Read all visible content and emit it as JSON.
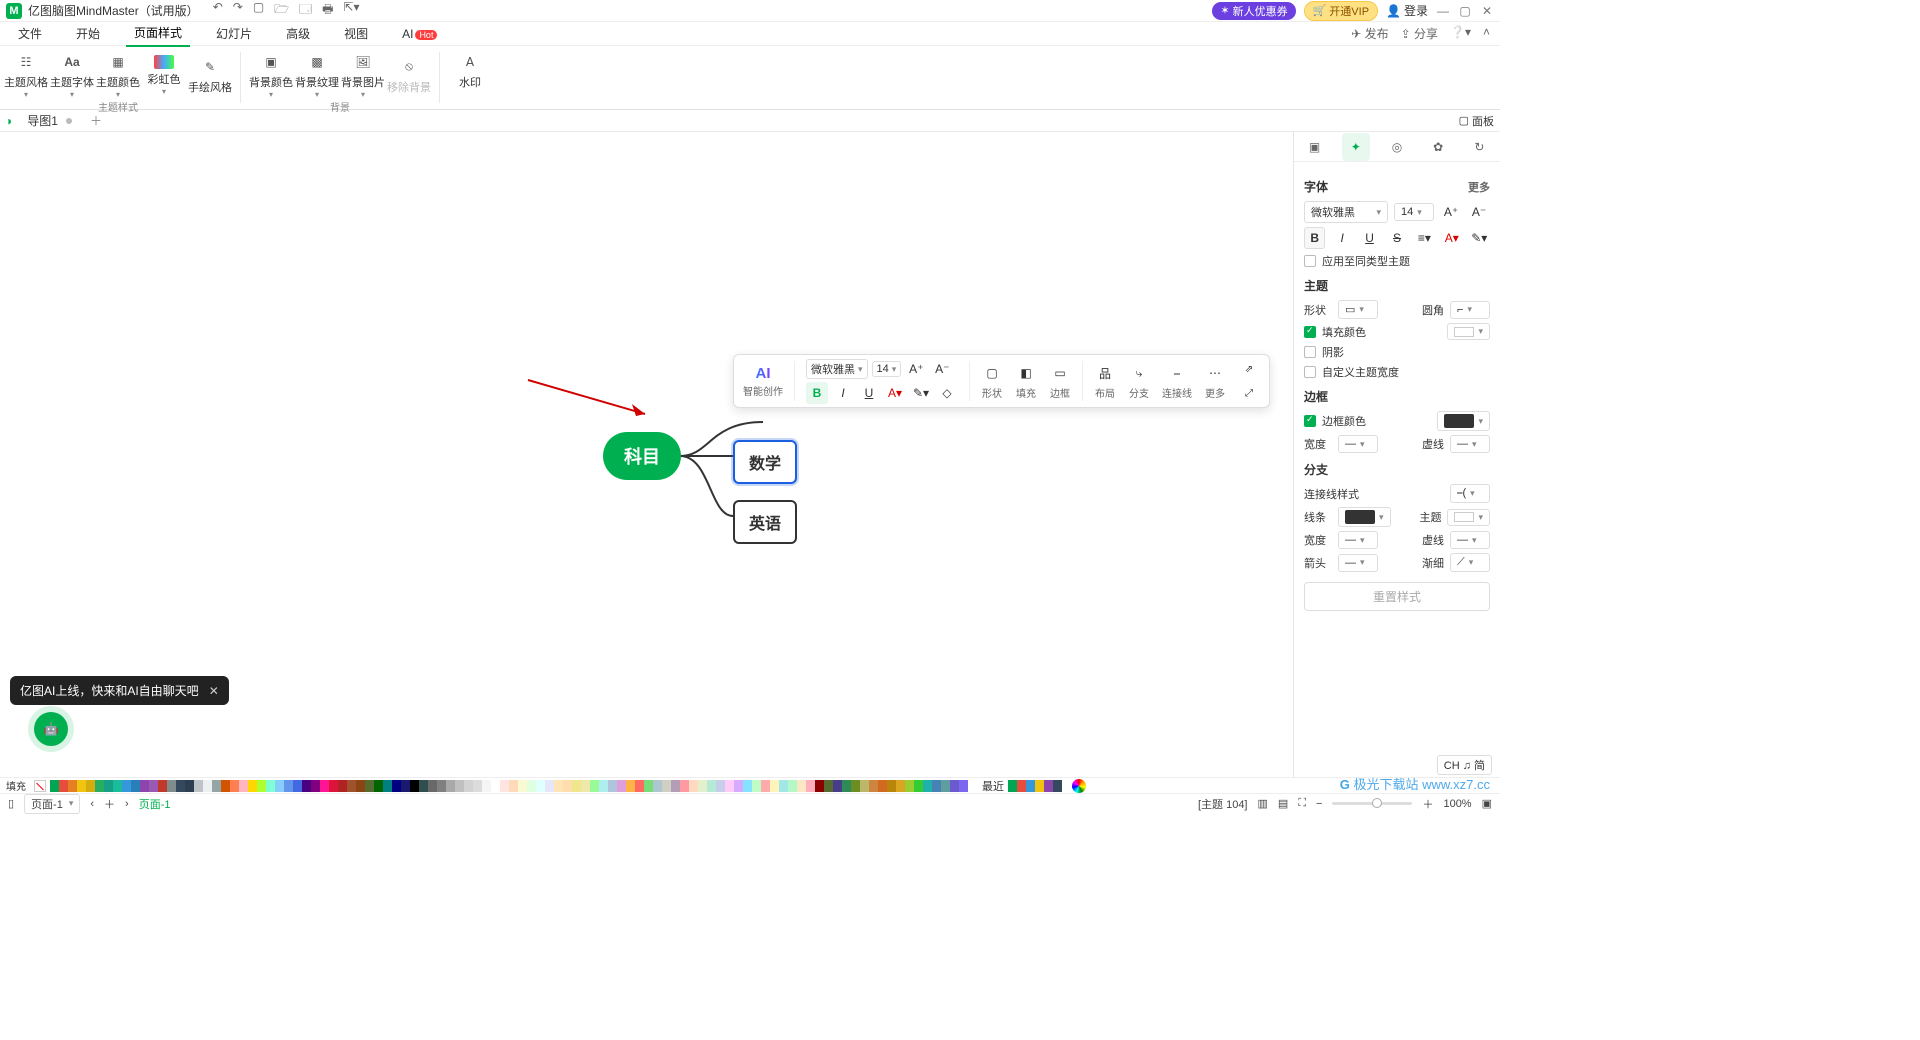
{
  "title": "亿图脑图MindMaster（试用版）",
  "titlebar_right": {
    "coupon": "新人优惠券",
    "vip": "开通VIP",
    "login": "登录"
  },
  "menubar": {
    "items": [
      "文件",
      "开始",
      "页面样式",
      "幻灯片",
      "高级",
      "视图",
      "AI"
    ],
    "active_index": 2,
    "right": {
      "publish": "发布",
      "share": "分享"
    }
  },
  "ribbon": {
    "group1_label": "主题样式",
    "group2_label": "背景",
    "items1": [
      "主题风格",
      "主题字体",
      "主题颜色",
      "彩虹色",
      "手绘风格"
    ],
    "items2": [
      "背景颜色",
      "背景纹理",
      "背景图片",
      "移除背景"
    ],
    "items3": [
      "水印"
    ]
  },
  "filetabs": {
    "tab": "导图1",
    "panel": "面板"
  },
  "mindmap": {
    "root": "科目",
    "child1": "数学",
    "child2": "英语"
  },
  "floatbar": {
    "ai": "AI",
    "ai_label": "智能创作",
    "font": "微软雅黑",
    "size": "14",
    "shape": "形状",
    "fill": "填充",
    "border": "边框",
    "layout": "布局",
    "branch": "分支",
    "connector": "连接线",
    "more": "更多"
  },
  "rightpanel": {
    "font_head": "字体",
    "more": "更多",
    "font_name": "微软雅黑",
    "font_size": "14",
    "apply_same": "应用至同类型主题",
    "theme_head": "主题",
    "shape": "形状",
    "radius": "圆角",
    "fill_color": "填充颜色",
    "shadow": "阴影",
    "custom_width": "自定义主题宽度",
    "border_head": "边框",
    "border_color": "边框颜色",
    "width": "宽度",
    "dashed": "虚线",
    "branch_head": "分支",
    "conn_style": "连接线样式",
    "line": "线条",
    "btheme": "主题",
    "bwidth": "宽度",
    "bdash": "虚线",
    "arrow": "箭头",
    "taper": "渐细",
    "reset": "重置样式"
  },
  "ai_bubble": "亿图AI上线，快来和AI自由聊天吧",
  "colorstrip": {
    "fill_label": "填充",
    "recent": "最近"
  },
  "statusbar": {
    "page": "页面-1",
    "pagetab": "页面-1",
    "theme_info": "[主题 104]",
    "zoom": "100%"
  },
  "ime": "CH ♫ 简",
  "watermark": "极光下载站  www.xz7.cc"
}
